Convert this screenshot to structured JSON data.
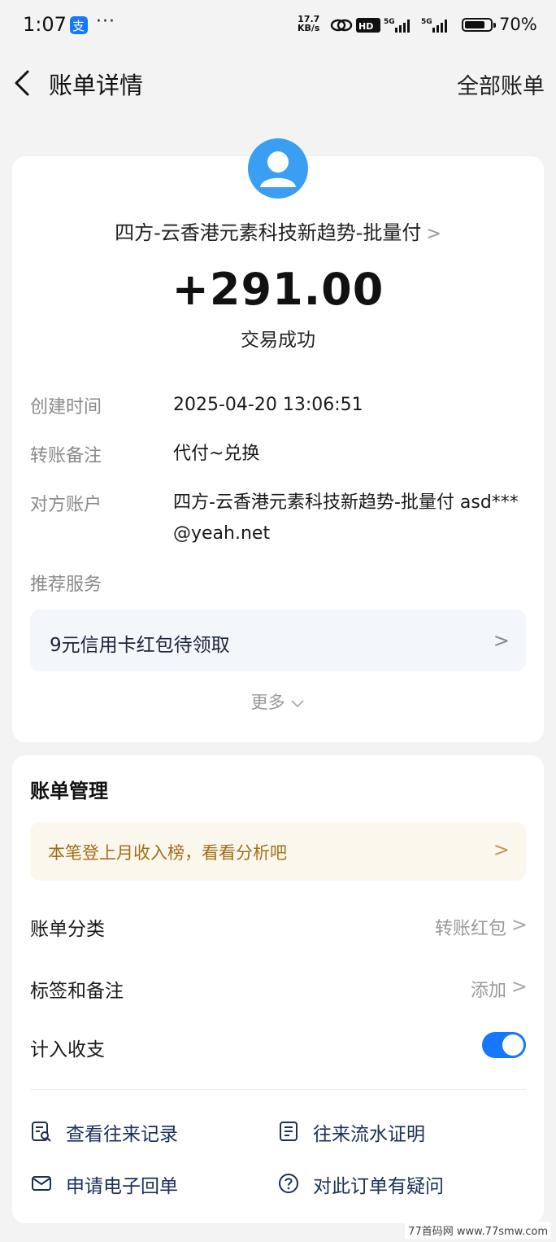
{
  "status_bar": {
    "time": "1:07",
    "dots": "···",
    "net_speed_value": "17.7",
    "net_speed_unit": "KB/s",
    "battery": "70%"
  },
  "nav": {
    "title": "账单详情",
    "right_link": "全部账单"
  },
  "transaction": {
    "payee": "四方-云香港元素科技新趋势-批量付",
    "amount": "+291.00",
    "status": "交易成功",
    "fields": [
      {
        "label": "创建时间",
        "value": "2025-04-20 13:06:51"
      },
      {
        "label": "转账备注",
        "value": "代付~兑换"
      },
      {
        "label": "对方账户",
        "value": "四方-云香港元素科技新趋势-批量付 asd***@yeah.net"
      }
    ],
    "recommend_label": "推荐服务",
    "promo": "9元信用卡红包待领取",
    "more": "更多"
  },
  "management": {
    "title": "账单管理",
    "tip": "本笔登上月收入榜，看看分析吧",
    "category_label": "账单分类",
    "category_value": "转账红包",
    "tag_label": "标签和备注",
    "tag_value": "添加",
    "count_label": "计入收支",
    "count_enabled": true,
    "actions": {
      "records": "查看往来记录",
      "statement": "往来流水证明",
      "receipt": "申请电子回单",
      "question": "对此订单有疑问"
    }
  },
  "watermark": "77首码网 www.77smw.com",
  "colors": {
    "accent": "#1677ff",
    "avatar": "#3a9ff2",
    "tip_text": "#a0701a",
    "action_text": "#1b2f5a"
  }
}
